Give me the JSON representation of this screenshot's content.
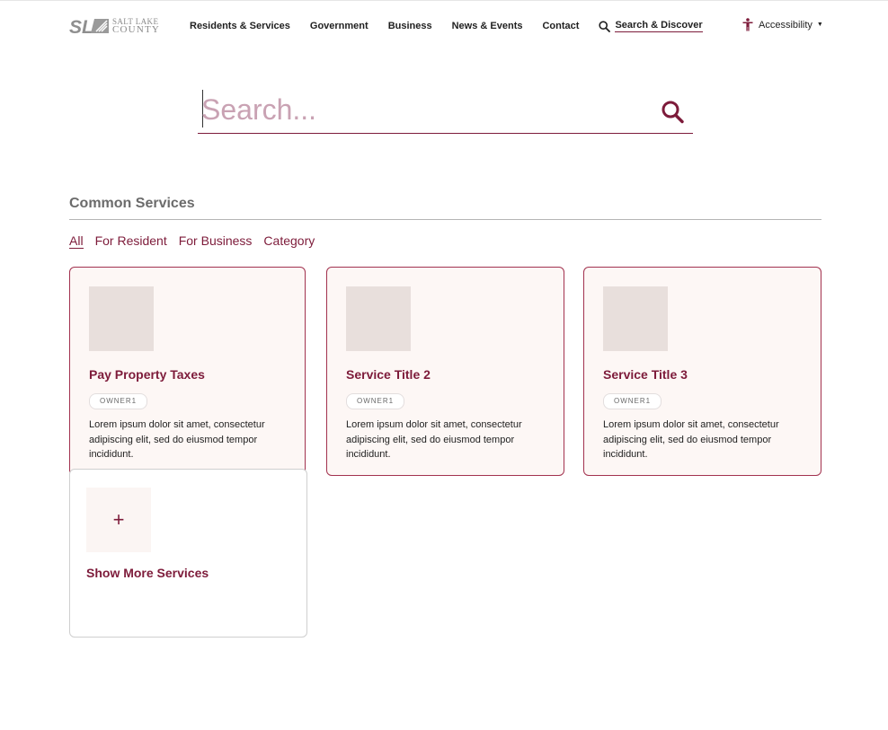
{
  "brand": {
    "logo_line1": "SALT LAKE",
    "logo_line2": "COUNTY",
    "accent": "#7d1b3a"
  },
  "nav": {
    "items": [
      "Residents & Services",
      "Government",
      "Business",
      "News & Events",
      "Contact"
    ],
    "search_label": "Search & Discover",
    "accessibility_label": "Accessibility"
  },
  "search": {
    "placeholder": "Search..."
  },
  "services": {
    "heading": "Common Services",
    "filters": [
      "All",
      "For Resident",
      "For Business",
      "Category"
    ],
    "active_filter": "All",
    "cards": [
      {
        "title": "Pay Property Taxes",
        "owner": "OWNER1",
        "description": "Lorem ipsum dolor sit amet, consectetur adipiscing elit, sed do eiusmod tempor incididunt."
      },
      {
        "title": "Service Title 2",
        "owner": "OWNER1",
        "description": "Lorem ipsum dolor sit amet, consectetur adipiscing elit, sed do eiusmod tempor incididunt."
      },
      {
        "title": "Service Title 3",
        "owner": "OWNER1",
        "description": "Lorem ipsum dolor sit amet, consectetur adipiscing elit, sed do eiusmod tempor incididunt."
      }
    ],
    "show_more": {
      "icon": "plus-icon",
      "label": "Show More Services"
    }
  }
}
